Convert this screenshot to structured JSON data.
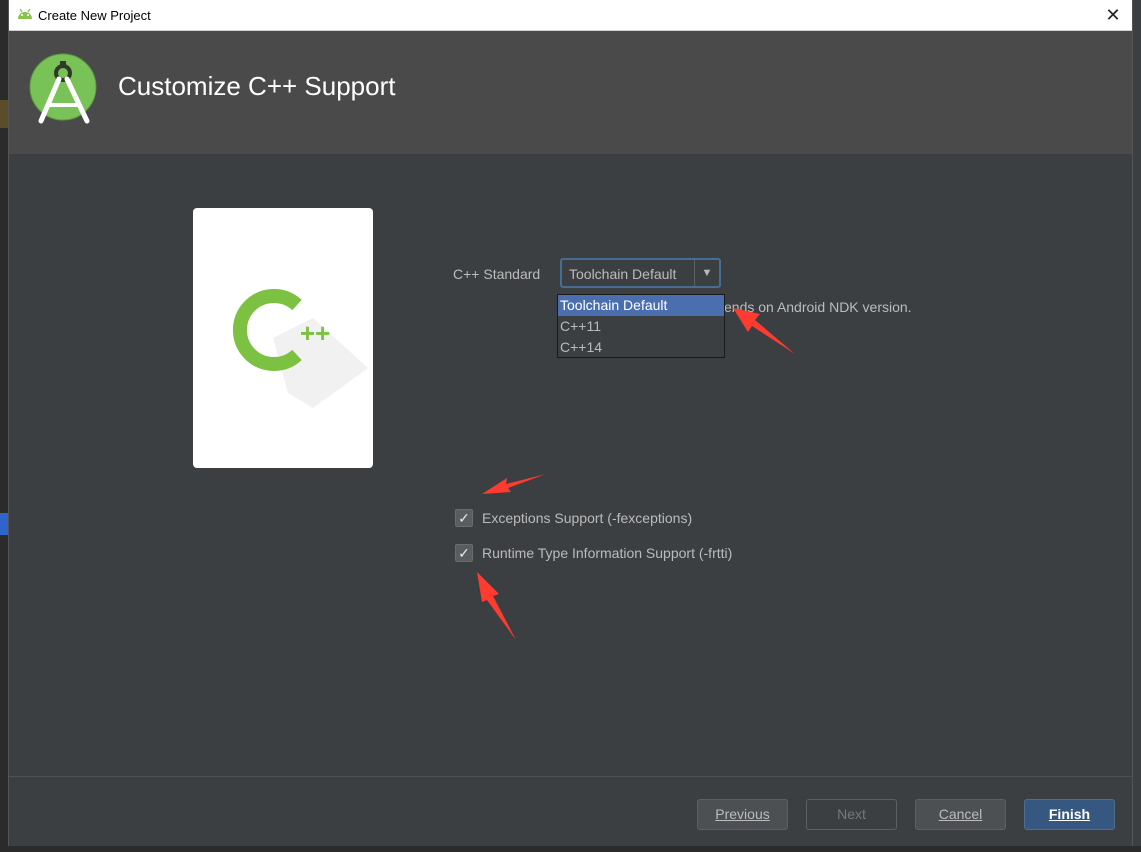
{
  "window": {
    "title": "Create New Project",
    "close_glyph": "✕"
  },
  "header": {
    "title": "Customize C++ Support",
    "logo_icon": "android-studio-logo-icon"
  },
  "card": {
    "icon": "cpp-icon",
    "glyph_c": "C",
    "glyph_pp": "++"
  },
  "form": {
    "cpp_standard_label": "C++ Standard",
    "cpp_standard_value": "Toolchain Default",
    "dropdown_arrow": "▼",
    "hint_text": "ends on Android NDK version.",
    "options": [
      "Toolchain Default",
      "C++11",
      "C++14"
    ],
    "selected_option_index": 0,
    "exceptions_label": "Exceptions Support (-fexceptions)",
    "exceptions_checked": true,
    "rtti_label": "Runtime Type Information Support (-frtti)",
    "rtti_checked": true,
    "check_glyph": "✓"
  },
  "footer": {
    "previous_label": "Previous",
    "next_label": "Next",
    "cancel_label": "Cancel",
    "finish_label": "Finish"
  },
  "colors": {
    "accent": "#4b6eaf",
    "annotation_arrow": "#ff3b30",
    "cpp_green": "#7cc142"
  }
}
